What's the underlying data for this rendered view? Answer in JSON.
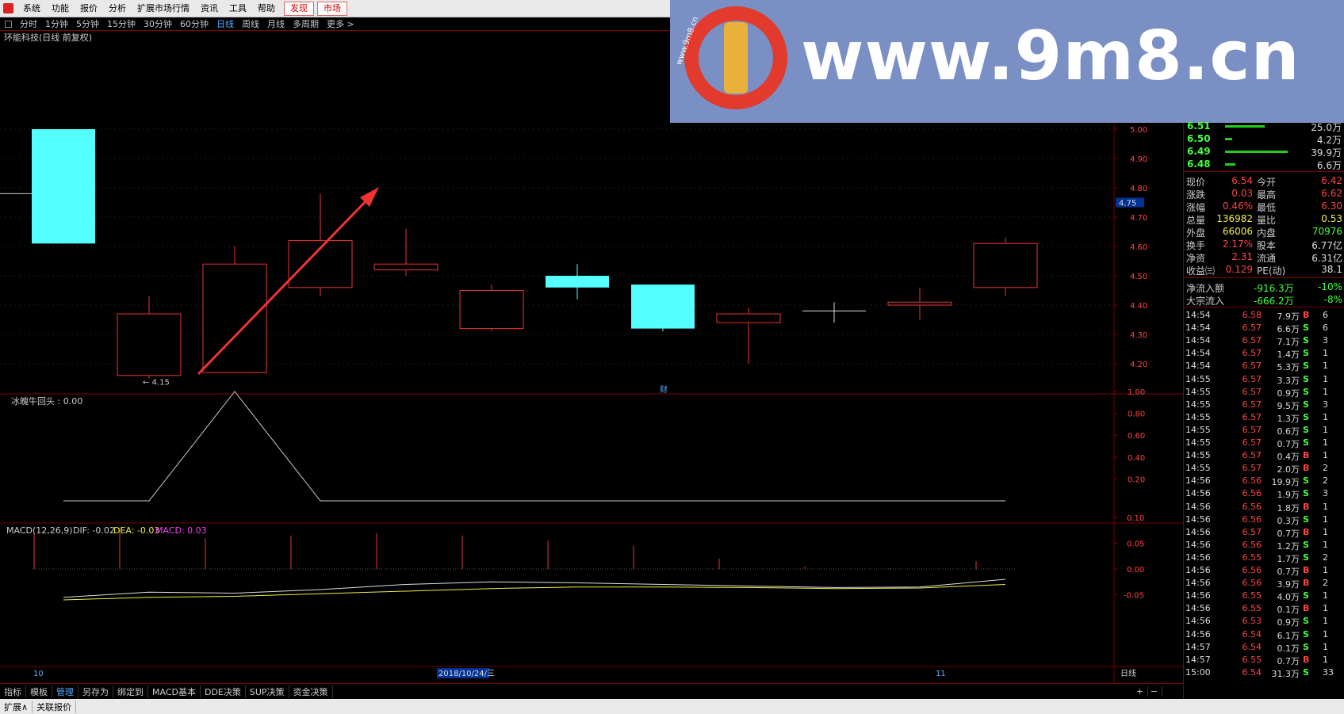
{
  "menu": {
    "items": [
      "系统",
      "功能",
      "报价",
      "分析",
      "扩展市场行情",
      "资讯",
      "工具",
      "帮助"
    ],
    "highlighted": [
      "发现",
      "市场"
    ]
  },
  "toolbar": {
    "periods": [
      "分时",
      "1分钟",
      "5分钟",
      "15分钟",
      "30分钟",
      "60分钟",
      "日线",
      "周线",
      "月线",
      "多周期",
      "更多 >"
    ],
    "active": "日线"
  },
  "chart_header": {
    "title": "环能科技(日线 前复权)",
    "indicator_label": "冰魄牛回头 : 0.00",
    "macd_label": "MACD(12,26,9)",
    "dif": "DIF: -0.02",
    "dea": "DEA: -0.03",
    "macd_value": "MACD: 0.03",
    "low_marker": "4.15",
    "fin_marker": "财",
    "date_label": "2018/10/24/三",
    "x_labels": [
      "10",
      "11"
    ],
    "period_corner": "日线",
    "price_tag": "4.75"
  },
  "watermark": {
    "text": "www.9m8.cn",
    "small": "www.9m8.cn"
  },
  "chart_data": [
    {
      "type": "candlestick",
      "yticks": [
        "5.00",
        "4.90",
        "4.80",
        "4.70",
        "4.60",
        "4.50",
        "4.40",
        "4.30",
        "4.20"
      ],
      "candles": [
        {
          "open": 4.61,
          "high": 5.0,
          "low": 4.61,
          "close": 5.0,
          "color": "cyan"
        },
        {
          "open": 4.16,
          "high": 4.43,
          "low": 4.15,
          "close": 4.37,
          "color": "red"
        },
        {
          "open": 4.17,
          "high": 4.6,
          "low": 4.17,
          "close": 4.54,
          "color": "red"
        },
        {
          "open": 4.46,
          "high": 4.78,
          "low": 4.43,
          "close": 4.62,
          "color": "red"
        },
        {
          "open": 4.52,
          "high": 4.66,
          "low": 4.5,
          "close": 4.54,
          "color": "red"
        },
        {
          "open": 4.32,
          "high": 4.47,
          "low": 4.31,
          "close": 4.45,
          "color": "red"
        },
        {
          "open": 4.5,
          "high": 4.54,
          "low": 4.42,
          "close": 4.46,
          "color": "cyan"
        },
        {
          "open": 4.47,
          "high": 4.47,
          "low": 4.31,
          "close": 4.32,
          "color": "cyan"
        },
        {
          "open": 4.34,
          "high": 4.39,
          "low": 4.2,
          "close": 4.37,
          "color": "red"
        },
        {
          "open": 4.38,
          "high": 4.41,
          "low": 4.34,
          "close": 4.38,
          "color": "white"
        },
        {
          "open": 4.4,
          "high": 4.46,
          "low": 4.35,
          "close": 4.41,
          "color": "red"
        },
        {
          "open": 4.46,
          "high": 4.63,
          "low": 4.43,
          "close": 4.61,
          "color": "red"
        }
      ],
      "prev_line": 4.78
    },
    {
      "type": "line",
      "name": "冰魄牛回头",
      "yticks": [
        "1.00",
        "0.80",
        "0.60",
        "0.40",
        "0.20"
      ],
      "values": [
        0,
        0,
        1,
        0,
        0,
        0,
        0,
        0,
        0,
        0,
        0,
        0
      ]
    },
    {
      "type": "bar+line",
      "name": "MACD",
      "yticks": [
        "0.10",
        "0.05",
        "0.00",
        "-0.05"
      ],
      "macd": [
        0.07,
        0.08,
        0.06,
        0.065,
        0.07,
        0.065,
        0.055,
        0.045,
        0.02,
        0.005,
        0.002,
        0.015
      ],
      "dif": [
        -0.055,
        -0.045,
        -0.047,
        -0.04,
        -0.03,
        -0.025,
        -0.027,
        -0.03,
        -0.033,
        -0.036,
        -0.035,
        -0.02
      ],
      "dea": [
        -0.06,
        -0.055,
        -0.053,
        -0.048,
        -0.043,
        -0.038,
        -0.035,
        -0.035,
        -0.036,
        -0.038,
        -0.037,
        -0.03
      ]
    }
  ],
  "orderbook": [
    {
      "price": "6.51",
      "volume": "25.0万",
      "bar": 0.45
    },
    {
      "price": "6.50",
      "volume": "4.2万",
      "bar": 0.08
    },
    {
      "price": "6.49",
      "volume": "39.9万",
      "bar": 0.72
    },
    {
      "price": "6.48",
      "volume": "6.6万",
      "bar": 0.12
    }
  ],
  "quote": [
    {
      "l1": "现价",
      "v1": "6.54",
      "l2": "今开",
      "v2": "6.42"
    },
    {
      "l1": "涨跌",
      "v1": "0.03",
      "l2": "最高",
      "v2": "6.62"
    },
    {
      "l1": "涨幅",
      "v1": "0.46%",
      "l2": "最低",
      "v2": "6.30"
    },
    {
      "l1": "总量",
      "v1": "136982",
      "l2": "量比",
      "v2": "0.53"
    },
    {
      "l1": "外盘",
      "v1": "66006",
      "l2": "内盘",
      "v2": "70976"
    },
    {
      "l1": "换手",
      "v1": "2.17%",
      "l2": "股本",
      "v2": "6.77亿"
    },
    {
      "l1": "净资",
      "v1": "2.31",
      "l2": "流通",
      "v2": "6.31亿"
    },
    {
      "l1": "收益㈢",
      "v1": "0.129",
      "l2": "PE(动)",
      "v2": "38.1"
    },
    {
      "l1": "净流入额",
      "v1": "",
      "l2": "-916.3万",
      "v2": "-10%"
    },
    {
      "l1": "大宗流入",
      "v1": "",
      "l2": "-666.2万",
      "v2": "-8%"
    }
  ],
  "ticks": [
    {
      "t": "14:54",
      "p": "6.58",
      "v": "7.9万",
      "d": "B",
      "n": "6"
    },
    {
      "t": "14:54",
      "p": "6.57",
      "v": "6.6万",
      "d": "S",
      "n": "6"
    },
    {
      "t": "14:54",
      "p": "6.57",
      "v": "7.1万",
      "d": "S",
      "n": "3"
    },
    {
      "t": "14:54",
      "p": "6.57",
      "v": "1.4万",
      "d": "S",
      "n": "1"
    },
    {
      "t": "14:54",
      "p": "6.57",
      "v": "5.3万",
      "d": "S",
      "n": "1"
    },
    {
      "t": "14:55",
      "p": "6.57",
      "v": "3.3万",
      "d": "S",
      "n": "1"
    },
    {
      "t": "14:55",
      "p": "6.57",
      "v": "0.9万",
      "d": "S",
      "n": "1"
    },
    {
      "t": "14:55",
      "p": "6.57",
      "v": "9.5万",
      "d": "S",
      "n": "3"
    },
    {
      "t": "14:55",
      "p": "6.57",
      "v": "1.3万",
      "d": "S",
      "n": "1"
    },
    {
      "t": "14:55",
      "p": "6.57",
      "v": "0.6万",
      "d": "S",
      "n": "1"
    },
    {
      "t": "14:55",
      "p": "6.57",
      "v": "0.7万",
      "d": "S",
      "n": "1"
    },
    {
      "t": "14:55",
      "p": "6.57",
      "v": "0.4万",
      "d": "B",
      "n": "1"
    },
    {
      "t": "14:55",
      "p": "6.57",
      "v": "2.0万",
      "d": "B",
      "n": "2"
    },
    {
      "t": "14:56",
      "p": "6.56",
      "v": "19.9万",
      "d": "S",
      "n": "2"
    },
    {
      "t": "14:56",
      "p": "6.56",
      "v": "1.9万",
      "d": "S",
      "n": "3"
    },
    {
      "t": "14:56",
      "p": "6.56",
      "v": "1.8万",
      "d": "B",
      "n": "1"
    },
    {
      "t": "14:56",
      "p": "6.56",
      "v": "0.3万",
      "d": "S",
      "n": "1"
    },
    {
      "t": "14:56",
      "p": "6.57",
      "v": "0.7万",
      "d": "B",
      "n": "1"
    },
    {
      "t": "14:56",
      "p": "6.56",
      "v": "1.2万",
      "d": "S",
      "n": "1"
    },
    {
      "t": "14:56",
      "p": "6.55",
      "v": "1.7万",
      "d": "S",
      "n": "2"
    },
    {
      "t": "14:56",
      "p": "6.56",
      "v": "0.7万",
      "d": "B",
      "n": "1"
    },
    {
      "t": "14:56",
      "p": "6.56",
      "v": "3.9万",
      "d": "B",
      "n": "2"
    },
    {
      "t": "14:56",
      "p": "6.55",
      "v": "4.0万",
      "d": "S",
      "n": "1"
    },
    {
      "t": "14:56",
      "p": "6.55",
      "v": "0.1万",
      "d": "B",
      "n": "1"
    },
    {
      "t": "14:56",
      "p": "6.53",
      "v": "0.9万",
      "d": "S",
      "n": "1"
    },
    {
      "t": "14:56",
      "p": "6.54",
      "v": "6.1万",
      "d": "S",
      "n": "1"
    },
    {
      "t": "14:57",
      "p": "6.54",
      "v": "0.1万",
      "d": "S",
      "n": "1"
    },
    {
      "t": "14:57",
      "p": "6.55",
      "v": "0.7万",
      "d": "B",
      "n": "1"
    },
    {
      "t": "15:00",
      "p": "6.54",
      "v": "31.3万",
      "d": "S",
      "n": "33"
    }
  ],
  "bottom_tabs": [
    "指标",
    "模板",
    "管理",
    "另存为",
    "绑定到",
    "MACD基本",
    "DDE决策",
    "SUP决策",
    "资金决策"
  ],
  "bottom_active": "管理",
  "status": [
    "扩展∧",
    "关联报价"
  ]
}
